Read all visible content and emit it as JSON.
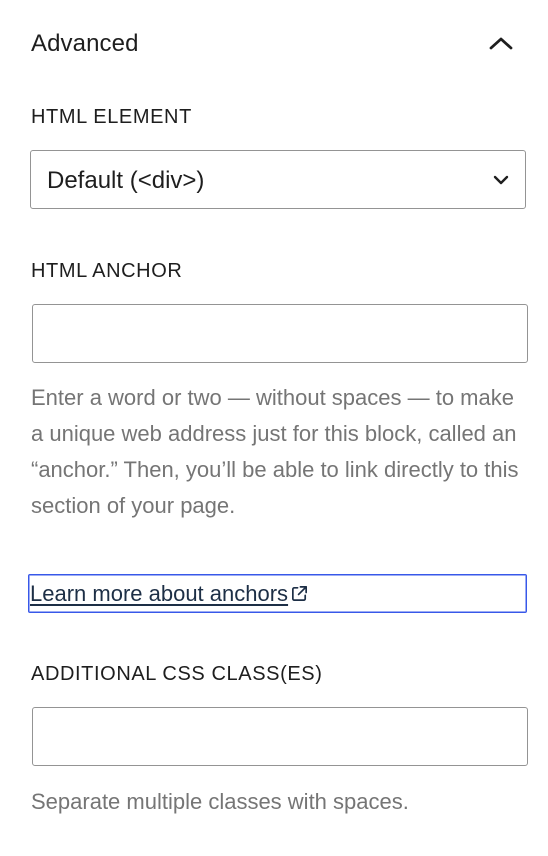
{
  "panel": {
    "title": "Advanced",
    "toggle_icon": "chevron-up-icon"
  },
  "html_element": {
    "label": "HTML ELEMENT",
    "selected_value": "Default (<div>)",
    "dropdown_icon": "chevron-down-icon"
  },
  "html_anchor": {
    "label": "HTML ANCHOR",
    "value": "",
    "placeholder": "",
    "help_text": "Enter a word or two — without spaces — to make a unique web address just for this block, called an “anchor.” Then, you’ll be able to link directly to this section of your page.",
    "link_text": "Learn more about anchors",
    "link_icon": "external-link-icon"
  },
  "css_classes": {
    "label": "ADDITIONAL CSS CLASS(ES)",
    "value": "",
    "placeholder": "",
    "help_text": "Separate multiple classes with spaces."
  },
  "colors": {
    "text": "#1e1e1e",
    "muted_text": "#757575",
    "border": "#949494",
    "focus": "#3858e9",
    "link": "#1d2f46"
  }
}
